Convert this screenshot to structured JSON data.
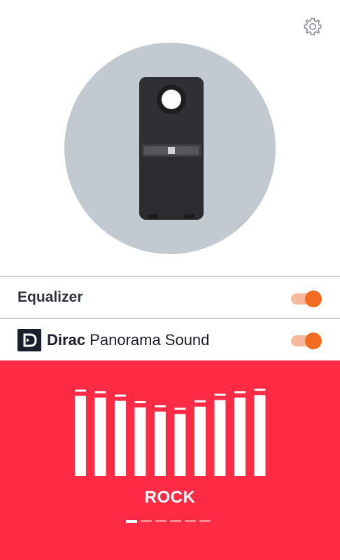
{
  "header": {
    "settings_icon": "gear-icon",
    "device_image": "speaker-mod-image"
  },
  "settings": {
    "equalizer_label": "Equalizer",
    "equalizer_on": true,
    "dirac_brand": "Dirac",
    "dirac_label": "Panorama Sound",
    "dirac_on": true
  },
  "equalizer": {
    "preset": "ROCK",
    "band_levels": [
      0.97,
      0.95,
      0.91,
      0.83,
      0.78,
      0.75,
      0.84,
      0.92,
      0.95,
      0.98
    ],
    "preset_count": 6,
    "active_preset_index": 0
  },
  "colors": {
    "accent": "#f26b21",
    "accent_track": "#f6b99b",
    "eq_background": "#ff2a43",
    "device_circle": "#c3c9d1"
  }
}
